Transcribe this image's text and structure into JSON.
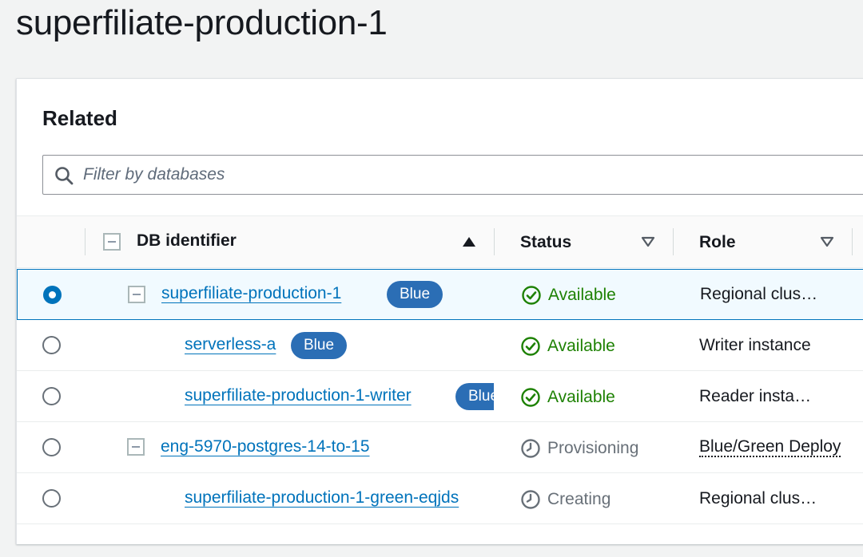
{
  "page": {
    "title": "superfiliate-production-1"
  },
  "related": {
    "heading": "Related",
    "filter": {
      "placeholder": "Filter by databases",
      "value": ""
    },
    "columns": [
      {
        "label": "DB identifier",
        "sort": "ascending"
      },
      {
        "label": "Status",
        "sort": "none"
      },
      {
        "label": "Role",
        "sort": "none"
      }
    ],
    "rows": [
      {
        "identifier": "superfiliate-production-1",
        "badge": "Blue",
        "status": "Available",
        "status_type": "available",
        "role": "Regional clus…",
        "selected": true
      },
      {
        "identifier": "serverless-a",
        "badge": "Blue",
        "status": "Available",
        "status_type": "available",
        "role": "Writer instance",
        "selected": false
      },
      {
        "identifier": "superfiliate-production-1-writer",
        "badge": "Blue",
        "status": "Available",
        "status_type": "available",
        "role": "Reader insta…",
        "selected": false
      },
      {
        "identifier": "eng-5970-postgres-14-to-15",
        "badge": "",
        "status": "Provisioning",
        "status_type": "pending",
        "role": "Blue/Green Deploy",
        "selected": false
      },
      {
        "identifier": "superfiliate-production-1-green-eqjds",
        "badge": "",
        "status": "Creating",
        "status_type": "pending",
        "role": "Regional clus…",
        "selected": false
      }
    ]
  },
  "colors": {
    "link": "#0073bb",
    "badge": "#2b6eb5",
    "available": "#1d8102",
    "pending": "#687078",
    "selected_row_bg": "#f1faff"
  },
  "icons": {
    "filter": "search-icon",
    "available": "check-circle-icon",
    "pending": "clock-icon",
    "sort_asc": "caret-up-icon",
    "sort_none": "caret-down-outline-icon"
  }
}
